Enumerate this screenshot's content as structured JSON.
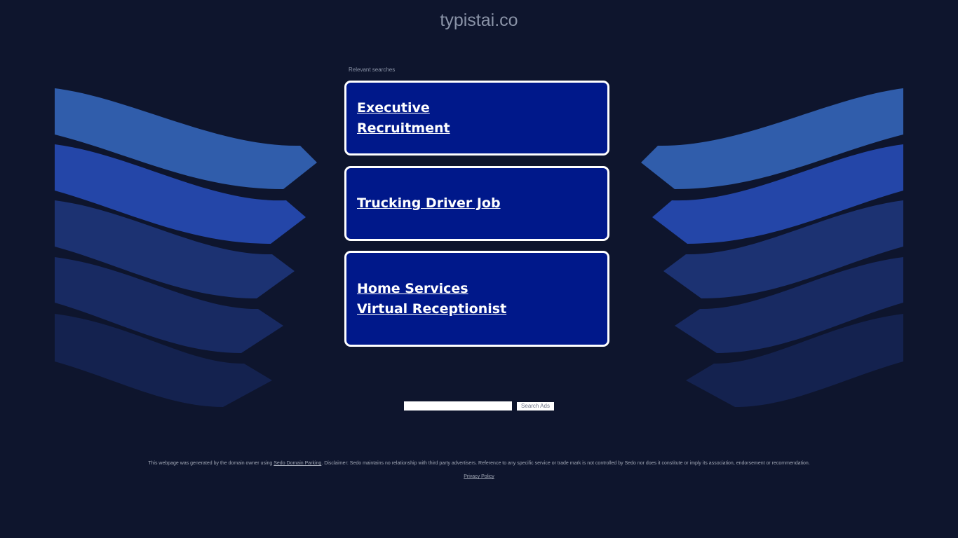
{
  "site": {
    "title": "typistai.co"
  },
  "ads": {
    "heading": "Relevant searches",
    "links": [
      {
        "label": "Executive Recruitment"
      },
      {
        "label": "Trucking Driver Job"
      },
      {
        "label": "Home Services Virtual Receptionist"
      }
    ]
  },
  "search": {
    "button_label": "Search Ads",
    "value": ""
  },
  "footer": {
    "disclaimer_prefix": "This webpage was generated by the domain owner using ",
    "disclaimer_link": "Sedo Domain Parking",
    "disclaimer_suffix": ". Disclaimer: Sedo maintains no relationship with third party advertisers. Reference to any specific service or trade mark is not controlled by Sedo nor does it constitute or imply its association, endorsement or recommendation.",
    "privacy_label": "Privacy Policy"
  },
  "colors": {
    "background": "#0e152d",
    "card_fill": "#00188a",
    "card_border": "#ffffff",
    "stripe_1": "#305dab",
    "stripe_2": "#2446a8",
    "stripe_3": "#1c3272",
    "stripe_4": "#182a62",
    "stripe_5": "#14224f"
  }
}
